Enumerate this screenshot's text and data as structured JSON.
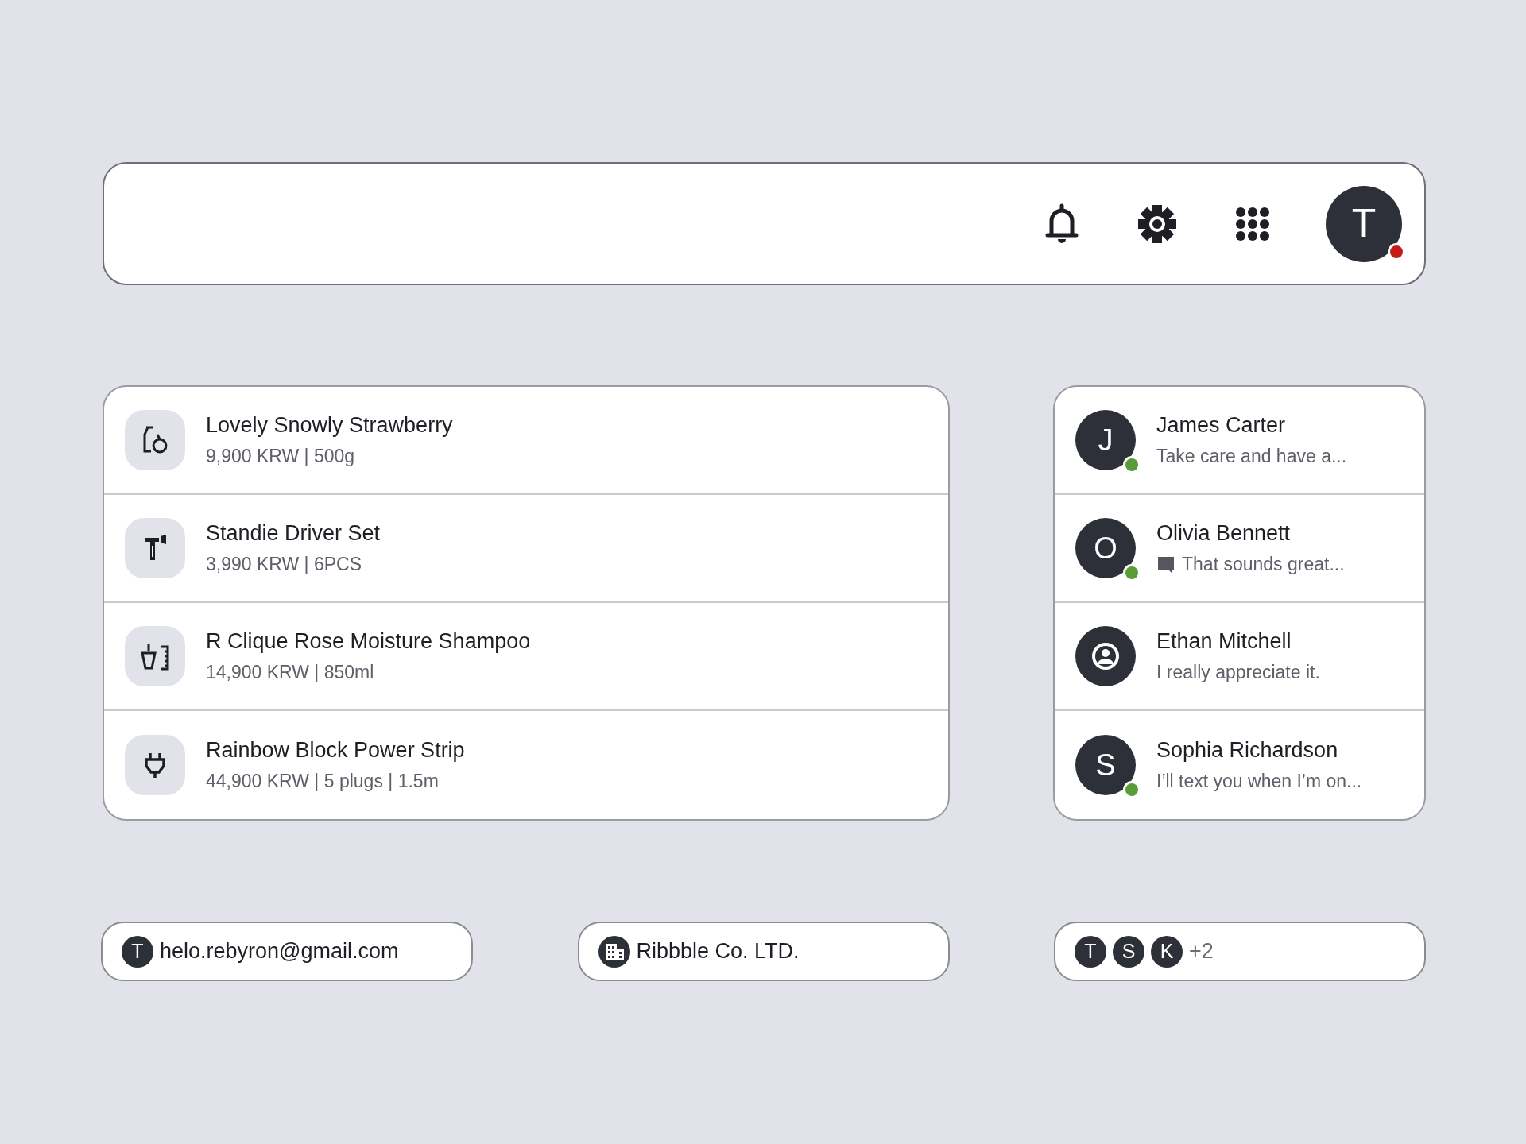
{
  "top_bar": {
    "user": {
      "initial": "T",
      "has_alert": true
    }
  },
  "products": [
    {
      "name": "Lovely Snowly Strawberry",
      "details": "9,900 KRW | 500g"
    },
    {
      "name": "Standie Driver Set",
      "details": "3,990 KRW | 6PCS"
    },
    {
      "name": "R Clique Rose Moisture Shampoo",
      "details": "14,900 KRW | 850ml"
    },
    {
      "name": "Rainbow Block Power Strip",
      "details": "44,900 KRW | 5 plugs | 1.5m"
    }
  ],
  "contacts": [
    {
      "avatar": {
        "kind": "letter",
        "letter": "J"
      },
      "online": true,
      "name": "James Carter",
      "chat_icon": false,
      "message": "Take care and have a..."
    },
    {
      "avatar": {
        "kind": "letter",
        "letter": "O"
      },
      "online": true,
      "name": "Olivia Bennett",
      "chat_icon": true,
      "message": "That sounds great..."
    },
    {
      "avatar": {
        "kind": "icon"
      },
      "online": false,
      "name": "Ethan Mitchell",
      "chat_icon": false,
      "message": "I really appreciate it."
    },
    {
      "avatar": {
        "kind": "letter",
        "letter": "S"
      },
      "online": true,
      "name": "Sophia Richardson",
      "chat_icon": false,
      "message": "I’ll text you when I’m on..."
    }
  ],
  "chips": [
    {
      "kind": "email",
      "initial": "T",
      "text": "helo.rebyron@gmail.com"
    },
    {
      "kind": "company",
      "text": "Ribbble Co. LTD."
    },
    {
      "kind": "members",
      "initials": [
        "T",
        "S",
        "K"
      ],
      "text": "+2"
    }
  ]
}
